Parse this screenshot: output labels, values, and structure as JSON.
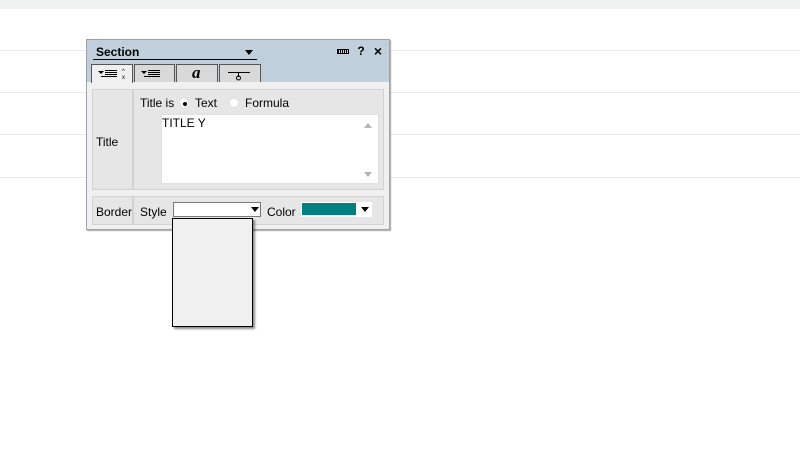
{
  "panel": {
    "section_label": "Section",
    "header_buttons": {
      "help": "?",
      "close": "×"
    },
    "tabs": [
      {
        "name": "title-layout-tab",
        "icon": "title-align-icon"
      },
      {
        "name": "align-tab",
        "icon": "align-icon"
      },
      {
        "name": "font-tab",
        "icon": "italic-a-icon",
        "glyph": "a"
      },
      {
        "name": "line-tab",
        "icon": "line-style-icon"
      }
    ]
  },
  "title_group": {
    "label": "Title",
    "title_is": "Title is",
    "option_text": "Text",
    "option_formula": "Formula",
    "selected": "Text",
    "text_value": "TITLE Y"
  },
  "border_group": {
    "label": "Border",
    "style_label": "Style",
    "style_value": "",
    "color_label": "Color",
    "color_value": "#008080"
  },
  "style_dropdown": {
    "options": []
  }
}
